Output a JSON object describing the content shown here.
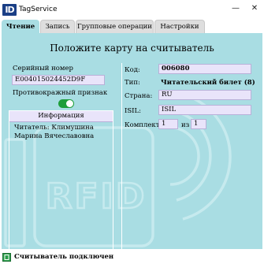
{
  "app": {
    "logo": "ID",
    "title": "TagService",
    "minimize": "—",
    "close": "✕"
  },
  "tabs": [
    {
      "label": "Чтение",
      "active": true
    },
    {
      "label": "Запись",
      "active": false
    },
    {
      "label": "Групповые операции",
      "active": false
    },
    {
      "label": "Настройки",
      "active": false
    }
  ],
  "main": {
    "heading": "Положите карту на считыватель",
    "serial_label": "Серийный номер",
    "serial_value": "E004015024452D9F",
    "anti_theft_label": "Противокражный признак",
    "anti_theft_on": true,
    "info_header": "Информация",
    "info_text": "Читатель:  Климушина Марина Вячеславовна",
    "watermark_text": "RFID"
  },
  "card": {
    "code_label": "Код:",
    "code_value": "006080",
    "type_label": "Тип:",
    "type_value": "Читательский билет (8)",
    "country_label": "Страна:",
    "country_value": "RU",
    "isil_label": "ISIL:",
    "isil_value": "ISIL",
    "set_label": "Комплект:",
    "set_value": "1",
    "of_label": "из",
    "of_value": "1"
  },
  "status": {
    "text": "Считыватель подключен",
    "icon": "usb-reader-icon"
  },
  "colors": {
    "panel": "#a9dde3",
    "field": "#e9e4fa",
    "toggle": "#1e9e3a",
    "logo": "#1a3f86"
  }
}
